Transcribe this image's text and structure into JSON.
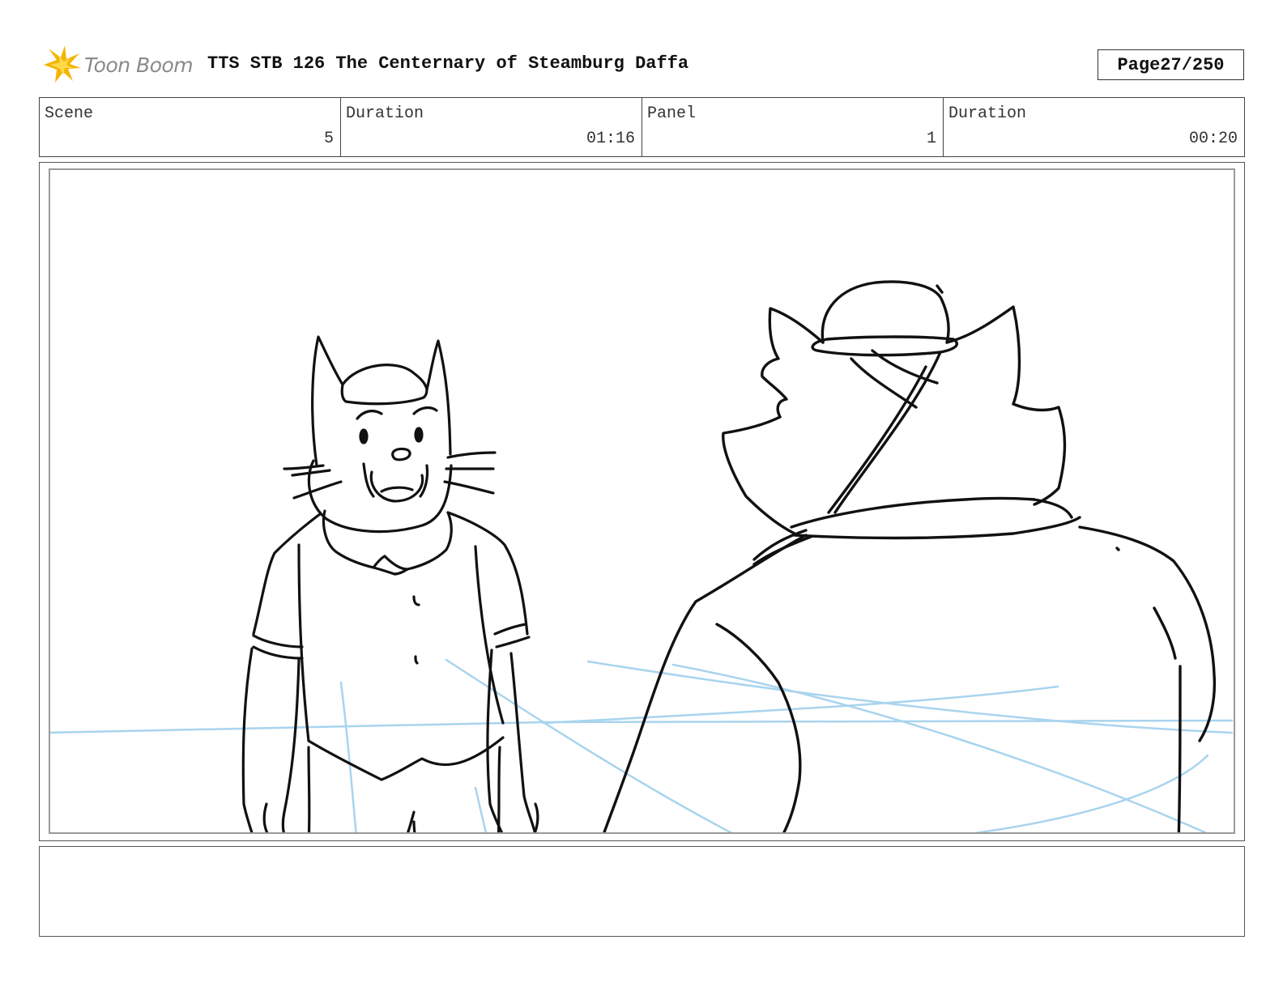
{
  "header": {
    "logo_text": "Toon Boom",
    "title": "TTS STB 126 The Centernary of Steamburg Daffa",
    "page_label": "Page",
    "page_value": "27/250"
  },
  "info": {
    "scene_label": "Scene",
    "scene_value": "5",
    "scene_duration_label": "Duration",
    "scene_duration_value": "01:16",
    "panel_label": "Panel",
    "panel_value": "1",
    "panel_duration_label": "Duration",
    "panel_duration_value": "00:20"
  },
  "colors": {
    "logo_accent": "#f5b400",
    "sketch_line": "#111111",
    "guide_line": "#a9d4ee"
  },
  "notes": {
    "text": ""
  }
}
